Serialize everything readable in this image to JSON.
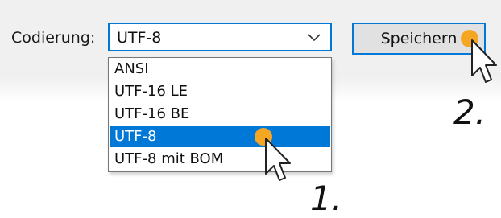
{
  "encoding": {
    "label": "Codierung:",
    "selected": "UTF-8",
    "options": [
      "ANSI",
      "UTF-16 LE",
      "UTF-16 BE",
      "UTF-8",
      "UTF-8 mit BOM"
    ],
    "highlighted_option": "UTF-8"
  },
  "toolbar": {
    "save_label": "Speichern"
  },
  "annotations": {
    "step1": "1.",
    "step2": "2."
  },
  "colors": {
    "accent": "#0078d7",
    "highlight_dot": "#f5a623",
    "toolbar_bg": "#f0f0f0",
    "button_bg": "#e1e1e1"
  },
  "icons": {
    "dropdown": "chevron-down-icon",
    "pointer": "mouse-cursor-icon"
  }
}
